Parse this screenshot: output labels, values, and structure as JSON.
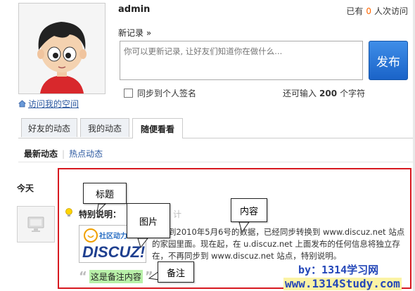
{
  "profile": {
    "username": "admin",
    "visits_prefix": "已有",
    "visits_count": "0",
    "visits_suffix": "人次访问",
    "visit_space_link": "访问我的空间"
  },
  "status": {
    "new_record_label": "新记录 »",
    "placeholder": "你可以更新记录, 让好友们知道你在做什么...",
    "publish_button": "发布",
    "sync_label": "同步到个人签名",
    "chars_prefix": "还可输入",
    "chars_count": "200",
    "chars_suffix": "个字符"
  },
  "tabs": [
    {
      "label": "好友的动态",
      "active": false
    },
    {
      "label": "我的动态",
      "active": false
    },
    {
      "label": "随便看看",
      "active": true
    }
  ],
  "subtabs": {
    "current": "最新动态",
    "separator": "|",
    "other": "热点动态"
  },
  "feed": {
    "day_label": "今天",
    "item_title": "特别说明：",
    "content": "截止到2010年5月6号的数据，已经同步转换到 www.discuz.net 站点的家园里面。现在起，在 u.discuz.net 上面发布的任何信息将独立存在，不再同步到 www.discuz.net 站点，特别说明。",
    "note": "这是备注内容",
    "logo_top_text": "社区动力",
    "logo_text": "DISCUZ!"
  },
  "callouts": {
    "title": "标题",
    "image": "图片",
    "content": "内容",
    "note": "备注"
  },
  "watermark": {
    "line1": "by：1314学习网",
    "line2": "www.1314Study.com"
  },
  "colors": {
    "accent_blue": "#1a63c8",
    "frame_red": "#d71920",
    "note_green": "#b8f0a8",
    "visits_orange": "#ff6600"
  }
}
